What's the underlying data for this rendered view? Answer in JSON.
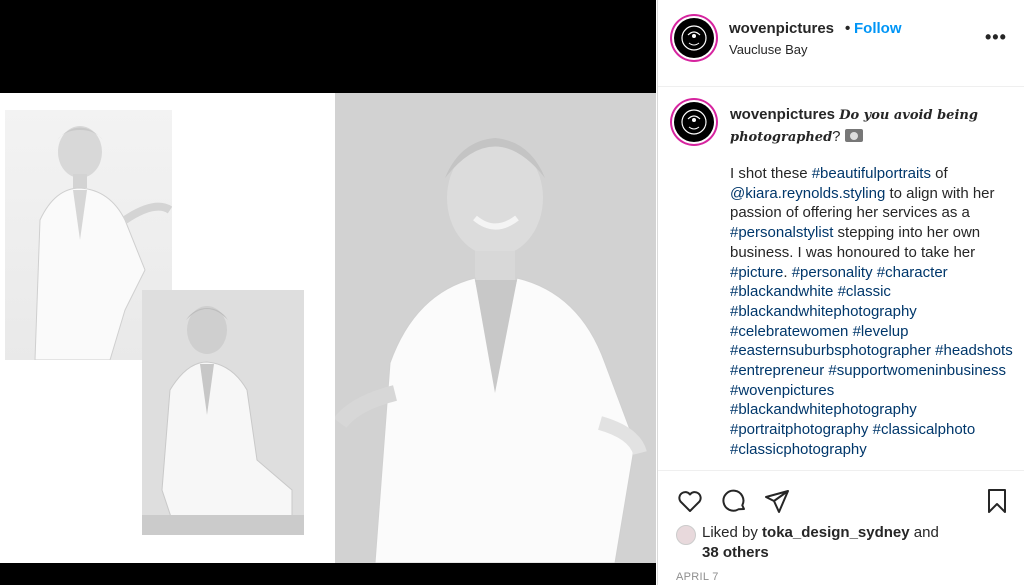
{
  "header": {
    "username": "wovenpictures",
    "separator": "•",
    "follow_label": "Follow",
    "location": "Vaucluse Bay",
    "more_label": "•••"
  },
  "caption": {
    "username": "wovenpictures",
    "headline_italic": "Do you avoid being photographed",
    "headline_end": "?",
    "camera_icon": "camera-icon",
    "body": [
      {
        "t": "I shot these ",
        "tag": false
      },
      {
        "t": "#beautifulportraits",
        "tag": true
      },
      {
        "t": " of ",
        "tag": false
      },
      {
        "t": "@kiara.reynolds.styling",
        "tag": true
      },
      {
        "t": " to align with her passion of offering her services as a ",
        "tag": false
      },
      {
        "t": "#personalstylist",
        "tag": true
      },
      {
        "t": " stepping into her own business. I was honoured to take her ",
        "tag": false
      },
      {
        "t": "#picture",
        "tag": true
      },
      {
        "t": ". ",
        "tag": false
      },
      {
        "t": "#personality",
        "tag": true
      },
      {
        "t": " ",
        "tag": false
      },
      {
        "t": "#character",
        "tag": true
      },
      {
        "t": " ",
        "tag": false
      },
      {
        "t": "#blackandwhite",
        "tag": true
      },
      {
        "t": " ",
        "tag": false
      },
      {
        "t": "#classic",
        "tag": true
      },
      {
        "t": " ",
        "tag": false
      },
      {
        "t": "#blackandwhitephotography",
        "tag": true
      },
      {
        "t": " ",
        "tag": false
      },
      {
        "t": "#celebratewomen",
        "tag": true
      },
      {
        "t": " ",
        "tag": false
      },
      {
        "t": "#levelup",
        "tag": true
      },
      {
        "t": " ",
        "tag": false
      },
      {
        "t": "#easternsuburbsphotographer",
        "tag": true
      },
      {
        "t": " ",
        "tag": false
      },
      {
        "t": "#headshots",
        "tag": true
      },
      {
        "t": " ",
        "tag": false
      },
      {
        "t": "#entrepreneur",
        "tag": true
      },
      {
        "t": " ",
        "tag": false
      },
      {
        "t": "#supportwomeninbusiness",
        "tag": true
      },
      {
        "t": " ",
        "tag": false
      },
      {
        "t": "#wovenpictures",
        "tag": true
      },
      {
        "t": " ",
        "tag": false
      },
      {
        "t": "#blackandwhitephotography",
        "tag": true
      },
      {
        "t": " ",
        "tag": false
      },
      {
        "t": "#portraitphotography",
        "tag": true
      },
      {
        "t": " ",
        "tag": false
      },
      {
        "t": "#classicalphoto",
        "tag": true
      },
      {
        "t": " ",
        "tag": false
      },
      {
        "t": "#classicphotography",
        "tag": true
      }
    ]
  },
  "actions": {
    "icons": [
      "heart-icon",
      "comment-icon",
      "share-icon",
      "bookmark-icon"
    ]
  },
  "likes": {
    "prefix": "Liked by ",
    "user": "toka_design_sydney",
    "middle": " and",
    "others": "38 others"
  },
  "date": "APRIL 7",
  "colors": {
    "link": "#0095f6",
    "hashtag": "#00376b",
    "ring": "#d6249f"
  }
}
